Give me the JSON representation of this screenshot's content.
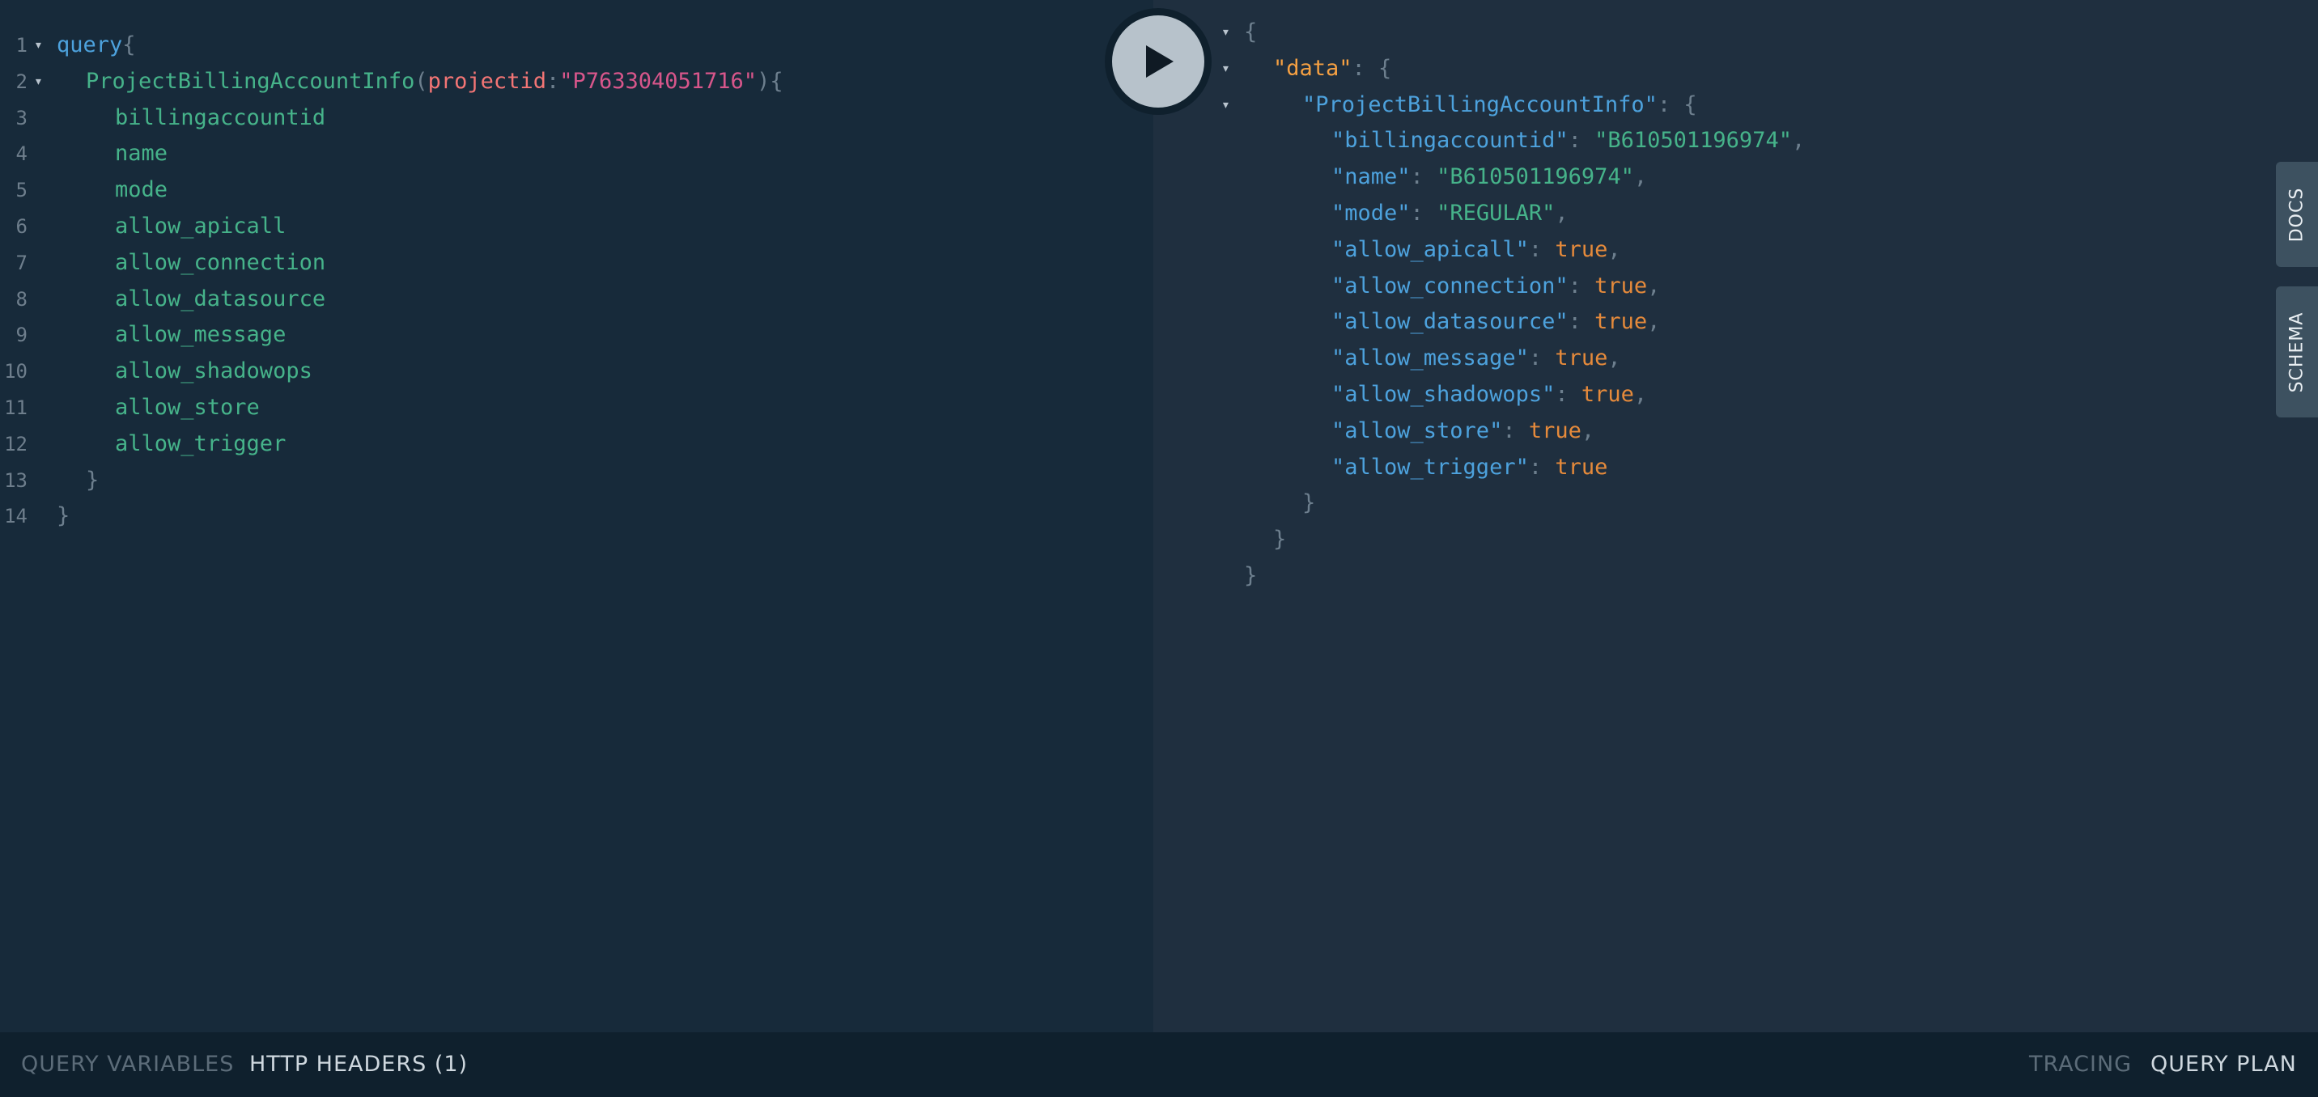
{
  "editor": {
    "lines": [
      {
        "n": "1",
        "parts": [
          {
            "t": "query",
            "c": "kw"
          },
          {
            "t": "{",
            "c": "punct"
          }
        ]
      },
      {
        "n": "2",
        "parts": [
          {
            "t": "ProjectBillingAccountInfo",
            "c": "field"
          },
          {
            "t": "(",
            "c": "punct"
          },
          {
            "t": "projectid",
            "c": "argname"
          },
          {
            "t": ":",
            "c": "punct"
          },
          {
            "t": "\"P763304051716\"",
            "c": "string"
          },
          {
            "t": "){",
            "c": "punct"
          }
        ]
      },
      {
        "n": "3",
        "parts": [
          {
            "t": "billingaccountid",
            "c": "field"
          }
        ]
      },
      {
        "n": "4",
        "parts": [
          {
            "t": "name",
            "c": "field"
          }
        ]
      },
      {
        "n": "5",
        "parts": [
          {
            "t": "mode",
            "c": "field"
          }
        ]
      },
      {
        "n": "6",
        "parts": [
          {
            "t": "allow_apicall",
            "c": "field"
          }
        ]
      },
      {
        "n": "7",
        "parts": [
          {
            "t": "allow_connection",
            "c": "field"
          }
        ]
      },
      {
        "n": "8",
        "parts": [
          {
            "t": "allow_datasource",
            "c": "field"
          }
        ]
      },
      {
        "n": "9",
        "parts": [
          {
            "t": "allow_message",
            "c": "field"
          }
        ]
      },
      {
        "n": "10",
        "parts": [
          {
            "t": "allow_shadowops",
            "c": "field"
          }
        ]
      },
      {
        "n": "11",
        "parts": [
          {
            "t": "allow_store",
            "c": "field"
          }
        ]
      },
      {
        "n": "12",
        "parts": [
          {
            "t": "allow_trigger",
            "c": "field"
          }
        ]
      },
      {
        "n": "13",
        "parts": [
          {
            "t": "}",
            "c": "punct"
          }
        ]
      },
      {
        "n": "14",
        "parts": [
          {
            "t": "}",
            "c": "punct"
          }
        ]
      }
    ]
  },
  "result": {
    "lines": [
      {
        "parts": [
          {
            "t": "{",
            "c": "rpunct"
          }
        ]
      },
      {
        "parts": [
          {
            "t": "\"data\"",
            "c": "rkey-data"
          },
          {
            "t": ": {",
            "c": "rpunct"
          }
        ]
      },
      {
        "parts": [
          {
            "t": "\"ProjectBillingAccountInfo\"",
            "c": "rkey"
          },
          {
            "t": ": {",
            "c": "rpunct"
          }
        ]
      },
      {
        "parts": [
          {
            "t": "\"billingaccountid\"",
            "c": "rkey"
          },
          {
            "t": ": ",
            "c": "rpunct"
          },
          {
            "t": "\"B610501196974\"",
            "c": "rstr"
          },
          {
            "t": ",",
            "c": "rpunct"
          }
        ]
      },
      {
        "parts": [
          {
            "t": "\"name\"",
            "c": "rkey"
          },
          {
            "t": ": ",
            "c": "rpunct"
          },
          {
            "t": "\"B610501196974\"",
            "c": "rstr"
          },
          {
            "t": ",",
            "c": "rpunct"
          }
        ]
      },
      {
        "parts": [
          {
            "t": "\"mode\"",
            "c": "rkey"
          },
          {
            "t": ": ",
            "c": "rpunct"
          },
          {
            "t": "\"REGULAR\"",
            "c": "rstr"
          },
          {
            "t": ",",
            "c": "rpunct"
          }
        ]
      },
      {
        "parts": [
          {
            "t": "\"allow_apicall\"",
            "c": "rkey"
          },
          {
            "t": ": ",
            "c": "rpunct"
          },
          {
            "t": "true",
            "c": "rbool"
          },
          {
            "t": ",",
            "c": "rpunct"
          }
        ]
      },
      {
        "parts": [
          {
            "t": "\"allow_connection\"",
            "c": "rkey"
          },
          {
            "t": ": ",
            "c": "rpunct"
          },
          {
            "t": "true",
            "c": "rbool"
          },
          {
            "t": ",",
            "c": "rpunct"
          }
        ]
      },
      {
        "parts": [
          {
            "t": "\"allow_datasource\"",
            "c": "rkey"
          },
          {
            "t": ": ",
            "c": "rpunct"
          },
          {
            "t": "true",
            "c": "rbool"
          },
          {
            "t": ",",
            "c": "rpunct"
          }
        ]
      },
      {
        "parts": [
          {
            "t": "\"allow_message\"",
            "c": "rkey"
          },
          {
            "t": ": ",
            "c": "rpunct"
          },
          {
            "t": "true",
            "c": "rbool"
          },
          {
            "t": ",",
            "c": "rpunct"
          }
        ]
      },
      {
        "parts": [
          {
            "t": "\"allow_shadowops\"",
            "c": "rkey"
          },
          {
            "t": ": ",
            "c": "rpunct"
          },
          {
            "t": "true",
            "c": "rbool"
          },
          {
            "t": ",",
            "c": "rpunct"
          }
        ]
      },
      {
        "parts": [
          {
            "t": "\"allow_store\"",
            "c": "rkey"
          },
          {
            "t": ": ",
            "c": "rpunct"
          },
          {
            "t": "true",
            "c": "rbool"
          },
          {
            "t": ",",
            "c": "rpunct"
          }
        ]
      },
      {
        "parts": [
          {
            "t": "\"allow_trigger\"",
            "c": "rkey"
          },
          {
            "t": ": ",
            "c": "rpunct"
          },
          {
            "t": "true",
            "c": "rbool"
          }
        ]
      },
      {
        "parts": [
          {
            "t": "}",
            "c": "rpunct"
          }
        ]
      },
      {
        "parts": [
          {
            "t": "}",
            "c": "rpunct"
          }
        ]
      },
      {
        "parts": [
          {
            "t": "}",
            "c": "rpunct"
          }
        ]
      }
    ]
  },
  "play_button": {
    "icon": "play-icon"
  },
  "side_tabs": {
    "docs": "DOCS",
    "schema": "SCHEMA"
  },
  "bottom": {
    "query_variables": "QUERY VARIABLES",
    "http_headers": "HTTP HEADERS (1)",
    "tracing": "TRACING",
    "query_plan": "QUERY PLAN"
  },
  "colors": {
    "editor_bg": "#172a3a",
    "result_bg": "#1f2f3f",
    "keyword": "#4da2dd",
    "field": "#46b38a",
    "arg": "#f37575",
    "string": "#d8568b",
    "bool": "#e58a3b"
  }
}
